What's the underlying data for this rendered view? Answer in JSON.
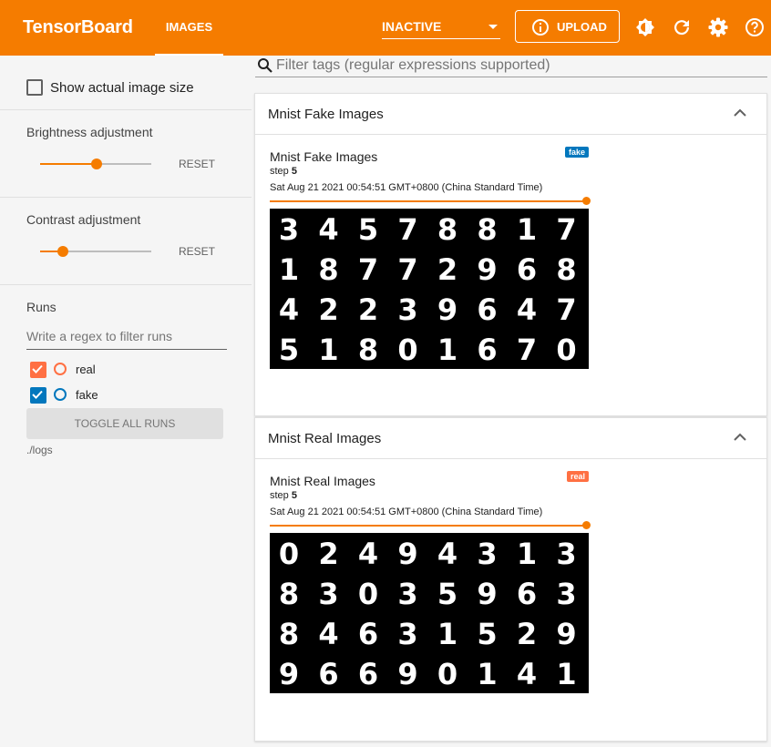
{
  "header": {
    "brand": "TensorBoard",
    "active_tab": "IMAGES",
    "plugin_select": "INACTIVE",
    "upload_label": "UPLOAD",
    "icons": [
      "info-icon",
      "theme-toggle-icon",
      "refresh-icon",
      "settings-icon",
      "help-icon"
    ],
    "accent_color": "#f57c00"
  },
  "sidebar": {
    "show_actual_size_label": "Show actual image size",
    "show_actual_size_checked": false,
    "brightness": {
      "label": "Brightness adjustment",
      "value": 0.5,
      "reset_label": "RESET"
    },
    "contrast": {
      "label": "Contrast adjustment",
      "value": 0.2,
      "reset_label": "RESET"
    },
    "runs": {
      "title": "Runs",
      "filter_placeholder": "Write a regex to filter runs",
      "items": [
        {
          "name": "real",
          "checked": true,
          "color": "#ff7043"
        },
        {
          "name": "fake",
          "checked": true,
          "color": "#0277bd"
        }
      ],
      "toggle_label": "TOGGLE ALL RUNS",
      "logdir": "./logs"
    }
  },
  "main": {
    "filter_placeholder": "Filter tags (regular expressions supported)",
    "cards": [
      {
        "header": "Mnist Fake Images",
        "image_title": "Mnist Fake Images",
        "run_tag": "fake",
        "run_color": "#0277bd",
        "step_label": "step",
        "step_value": "5",
        "timestamp": "Sat Aug 21 2021 00:54:51 GMT+0800 (China Standard Time)",
        "digits": [
          "3",
          "4",
          "5",
          "7",
          "8",
          "8",
          "1",
          "7",
          "1",
          "8",
          "7",
          "7",
          "2",
          "9",
          "6",
          "8",
          "4",
          "2",
          "2",
          "3",
          "9",
          "6",
          "4",
          "7",
          "5",
          "1",
          "8",
          "0",
          "1",
          "6",
          "7",
          "0"
        ]
      },
      {
        "header": "Mnist Real Images",
        "image_title": "Mnist Real Images",
        "run_tag": "real",
        "run_color": "#ff7043",
        "step_label": "step",
        "step_value": "5",
        "timestamp": "Sat Aug 21 2021 00:54:51 GMT+0800 (China Standard Time)",
        "digits": [
          "0",
          "2",
          "4",
          "9",
          "4",
          "3",
          "1",
          "3",
          "8",
          "3",
          "0",
          "3",
          "5",
          "9",
          "6",
          "3",
          "8",
          "4",
          "6",
          "3",
          "1",
          "5",
          "2",
          "9",
          "9",
          "6",
          "6",
          "9",
          "0",
          "1",
          "4",
          "1"
        ]
      }
    ]
  }
}
